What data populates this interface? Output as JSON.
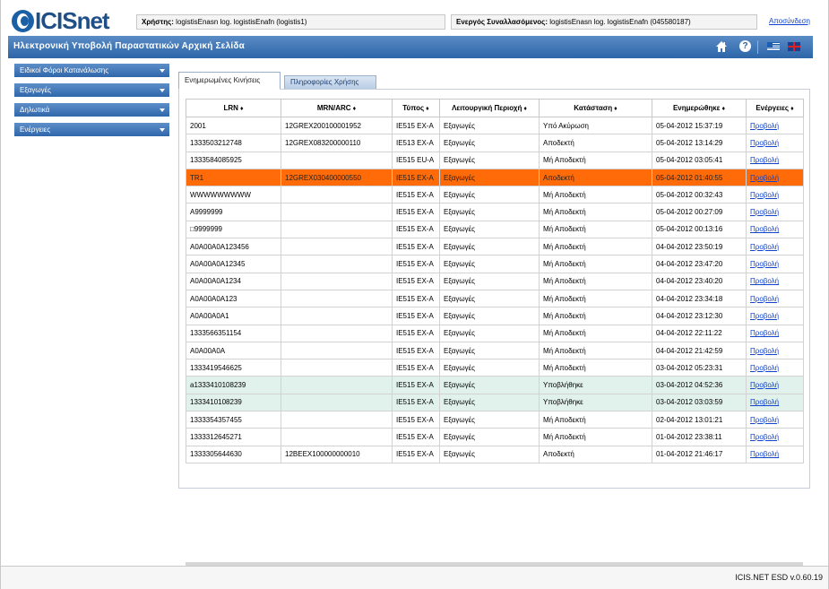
{
  "header": {
    "logo_text": "ICISnet",
    "user_label": "Χρήστης:",
    "user_value": "logistisEnasn log. logistisEnafn (logistis1)",
    "trader_label": "Ενεργός Συναλλασόμενος:",
    "trader_value": "logistisEnasn log. logistisEnafn (045580187)",
    "logout": "Αποσύνδεση"
  },
  "titlebar": {
    "title": "Ηλεκτρονική Υποβολή Παραστατικών Αρχική Σελίδα",
    "home_icon": "home-icon",
    "help_icon": "help-icon",
    "help_glyph": "?",
    "languages": [
      "greek-flag-icon",
      "uk-flag-icon"
    ]
  },
  "sidebar": {
    "items": [
      {
        "label": "Ειδικοί Φόροι Κατανάλωσης"
      },
      {
        "label": "Εξαγωγές"
      },
      {
        "label": "Δηλωτικά"
      },
      {
        "label": "Ενέργειες"
      }
    ]
  },
  "tabs": [
    {
      "label": "Ενημερωμένες Κινήσεις",
      "active": true
    },
    {
      "label": "Πληροφορίες Χρήσης",
      "active": false
    }
  ],
  "table": {
    "sort_glyph": "♦",
    "columns": [
      "LRN",
      "MRN/ARC",
      "Τύπος",
      "Λειτουργική Περιοχή",
      "Κατάσταση",
      "Ενημερώθηκε",
      "Ενέργειες"
    ],
    "rows": [
      {
        "lrn": "2001",
        "mrn": "12GREX200100001952",
        "type": "IE515 EX-A",
        "area": "Εξαγωγές",
        "status": "Υπό Ακύρωση",
        "updated": "05-04-2012 15:37:19",
        "action": "Προβολή"
      },
      {
        "lrn": "1333503212748",
        "mrn": "12GREX083200000110",
        "type": "IE513 EX-A",
        "area": "Εξαγωγές",
        "status": "Αποδεκτή",
        "updated": "05-04-2012 13:14:29",
        "action": "Προβολή"
      },
      {
        "lrn": "1333584085925",
        "mrn": "",
        "type": "IE515 EU-A",
        "area": "Εξαγωγές",
        "status": "Μή Αποδεκτή",
        "updated": "05-04-2012 03:05:41",
        "action": "Προβολή"
      },
      {
        "lrn": "TR1",
        "mrn": "12GREX030400000550",
        "type": "IE515 EX-A",
        "area": "Εξαγωγές",
        "status": "Αποδεκτή",
        "updated": "05-04-2012 01:40:55",
        "action": "Προβολή",
        "state": "selected"
      },
      {
        "lrn": "WWWWWWWWW",
        "mrn": "",
        "type": "IE515 EX-A",
        "area": "Εξαγωγές",
        "status": "Μή Αποδεκτή",
        "updated": "05-04-2012 00:32:43",
        "action": "Προβολή"
      },
      {
        "lrn": "A9999999",
        "mrn": "",
        "type": "IE515 EX-A",
        "area": "Εξαγωγές",
        "status": "Μή Αποδεκτή",
        "updated": "05-04-2012 00:27:09",
        "action": "Προβολή"
      },
      {
        "lrn": "□9999999",
        "mrn": "",
        "type": "IE515 EX-A",
        "area": "Εξαγωγές",
        "status": "Μή Αποδεκτή",
        "updated": "05-04-2012 00:13:16",
        "action": "Προβολή"
      },
      {
        "lrn": "A0A00A0A123456",
        "mrn": "",
        "type": "IE515 EX-A",
        "area": "Εξαγωγές",
        "status": "Μή Αποδεκτή",
        "updated": "04-04-2012 23:50:19",
        "action": "Προβολή"
      },
      {
        "lrn": "A0A00A0A12345",
        "mrn": "",
        "type": "IE515 EX-A",
        "area": "Εξαγωγές",
        "status": "Μή Αποδεκτή",
        "updated": "04-04-2012 23:47:20",
        "action": "Προβολή"
      },
      {
        "lrn": "A0A00A0A1234",
        "mrn": "",
        "type": "IE515 EX-A",
        "area": "Εξαγωγές",
        "status": "Μή Αποδεκτή",
        "updated": "04-04-2012 23:40:20",
        "action": "Προβολή"
      },
      {
        "lrn": "A0A00A0A123",
        "mrn": "",
        "type": "IE515 EX-A",
        "area": "Εξαγωγές",
        "status": "Μή Αποδεκτή",
        "updated": "04-04-2012 23:34:18",
        "action": "Προβολή"
      },
      {
        "lrn": "A0A00A0A1",
        "mrn": "",
        "type": "IE515 EX-A",
        "area": "Εξαγωγές",
        "status": "Μή Αποδεκτή",
        "updated": "04-04-2012 23:12:30",
        "action": "Προβολή"
      },
      {
        "lrn": "1333566351154",
        "mrn": "",
        "type": "IE515 EX-A",
        "area": "Εξαγωγές",
        "status": "Μή Αποδεκτή",
        "updated": "04-04-2012 22:11:22",
        "action": "Προβολή"
      },
      {
        "lrn": "A0A00A0A",
        "mrn": "",
        "type": "IE515 EX-A",
        "area": "Εξαγωγές",
        "status": "Μή Αποδεκτή",
        "updated": "04-04-2012 21:42:59",
        "action": "Προβολή"
      },
      {
        "lrn": "1333419546625",
        "mrn": "",
        "type": "IE515 EX-A",
        "area": "Εξαγωγές",
        "status": "Μή Αποδεκτή",
        "updated": "03-04-2012 05:23:31",
        "action": "Προβολή"
      },
      {
        "lrn": "a1333410108239",
        "mrn": "",
        "type": "IE515 EX-A",
        "area": "Εξαγωγές",
        "status": "Υποβλήθηκε",
        "updated": "03-04-2012 04:52:36",
        "action": "Προβολή",
        "state": "submitted"
      },
      {
        "lrn": "1333410108239",
        "mrn": "",
        "type": "IE515 EX-A",
        "area": "Εξαγωγές",
        "status": "Υποβλήθηκε",
        "updated": "03-04-2012 03:03:59",
        "action": "Προβολή",
        "state": "submitted"
      },
      {
        "lrn": "1333354357455",
        "mrn": "",
        "type": "IE515 EX-A",
        "area": "Εξαγωγές",
        "status": "Μή Αποδεκτή",
        "updated": "02-04-2012 13:01:21",
        "action": "Προβολή"
      },
      {
        "lrn": "1333312645271",
        "mrn": "",
        "type": "IE515 EX-A",
        "area": "Εξαγωγές",
        "status": "Μή Αποδεκτή",
        "updated": "01-04-2012 23:38:11",
        "action": "Προβολή"
      },
      {
        "lrn": "1333305644630",
        "mrn": "12BEEX100000000010",
        "type": "IE515 EX-A",
        "area": "Εξαγωγές",
        "status": "Αποδεκτή",
        "updated": "01-04-2012 21:46:17",
        "action": "Προβολή"
      }
    ]
  },
  "footer": {
    "version": "ICIS.NET ESD v.0.60.19"
  },
  "colors": {
    "brand_blue": "#2d65a8",
    "selected_row": "#ff6b08",
    "submitted_row": "#e1f1ec",
    "link": "#1144cc"
  }
}
